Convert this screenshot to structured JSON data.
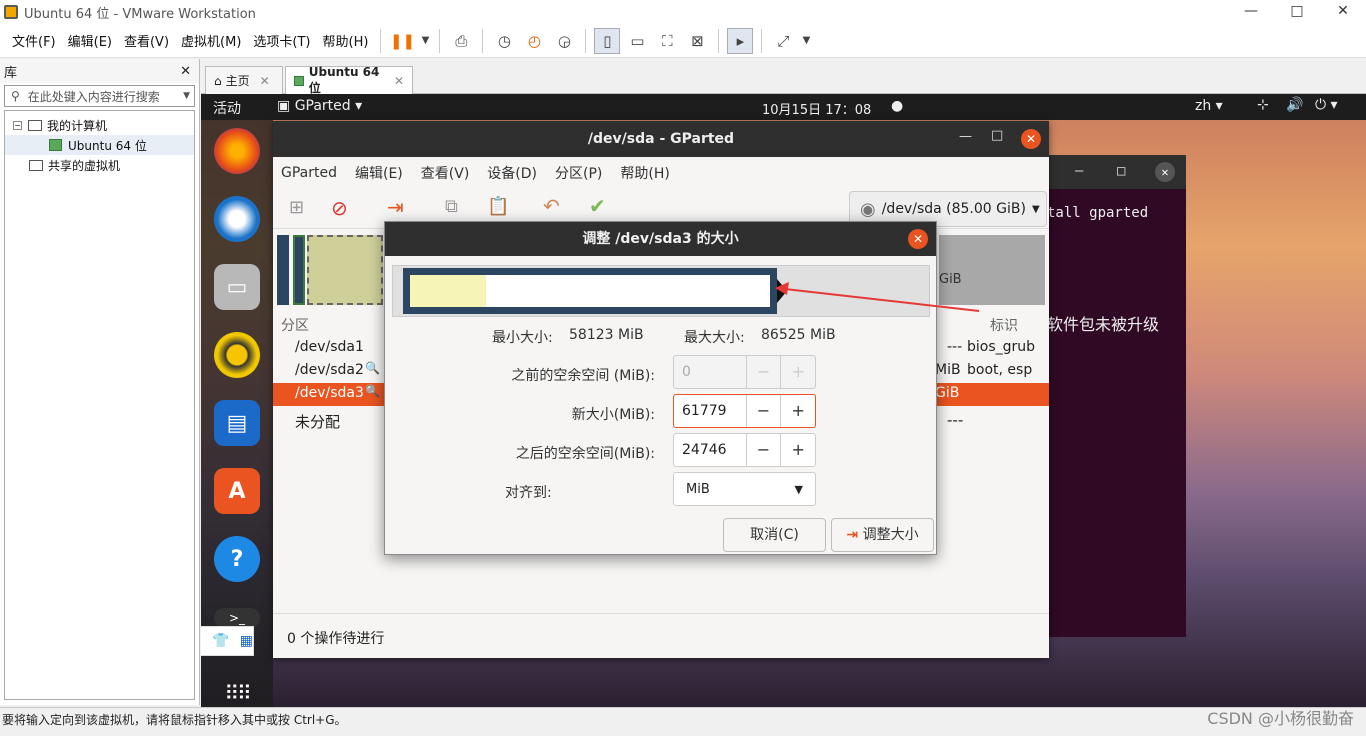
{
  "window": {
    "title": "Ubuntu 64 位 - VMware Workstation",
    "min": "—",
    "max": "□",
    "close": "✕"
  },
  "menu": [
    "文件(F)",
    "编辑(E)",
    "查看(V)",
    "虚拟机(M)",
    "选项卡(T)",
    "帮助(H)"
  ],
  "library": {
    "title": "库",
    "close": "✕",
    "search_placeholder": "在此处键入内容进行搜索",
    "tree": {
      "root": "我的计算机",
      "vm": "Ubuntu 64 位",
      "shared": "共享的虚拟机"
    }
  },
  "tabs": [
    {
      "label": "主页"
    },
    {
      "label": "Ubuntu 64 位"
    }
  ],
  "status": "要将输入定向到该虚拟机，请将鼠标指针移入其中或按 Ctrl+G。",
  "watermark": "CSDN @小杨很勤奋",
  "ubuntu": {
    "activities": "活动",
    "app": "GParted",
    "clock": "10月15日  17：08",
    "lang": "zh"
  },
  "gparted": {
    "title": "/dev/sda - GParted",
    "menu": [
      "GParted",
      "编辑(E)",
      "查看(V)",
      "设备(D)",
      "分区(P)",
      "帮助(H)"
    ],
    "device": "/dev/sda (85.00 GiB)",
    "col_partition": "分区",
    "col_flags": "标识",
    "rows": [
      {
        "name": "/dev/sda1",
        "tail": "---",
        "flags": "bios_grub"
      },
      {
        "name": "/dev/sda2",
        "tail": "MiB",
        "flags": "boot, esp"
      },
      {
        "name": "/dev/sda3",
        "tail": "GiB",
        "flags": ""
      },
      {
        "name": "未分配",
        "tail": "---",
        "flags": ""
      }
    ],
    "ops": "0 个操作待进行",
    "peek": "GiB"
  },
  "terminal": {
    "line1": "tall gparted",
    "line2": "软件包未被升级"
  },
  "dialog": {
    "title": "调整 /dev/sda3 的大小",
    "min_label": "最小大小:",
    "min_value": "58123 MiB",
    "max_label": "最大大小:",
    "max_value": "86525 MiB",
    "before_label": "之前的空余空间 (MiB):",
    "before_value": "0",
    "size_label": "新大小(MiB):",
    "size_value": "61779",
    "after_label": "之后的空余空间(MiB):",
    "after_value": "24746",
    "align_label": "对齐到:",
    "align_value": "MiB",
    "cancel": "取消(C)",
    "resize": "调整大小"
  },
  "colors": {
    "accent": "#e95420",
    "partition_border": "#2c4560",
    "used": "#f7f5b5"
  }
}
